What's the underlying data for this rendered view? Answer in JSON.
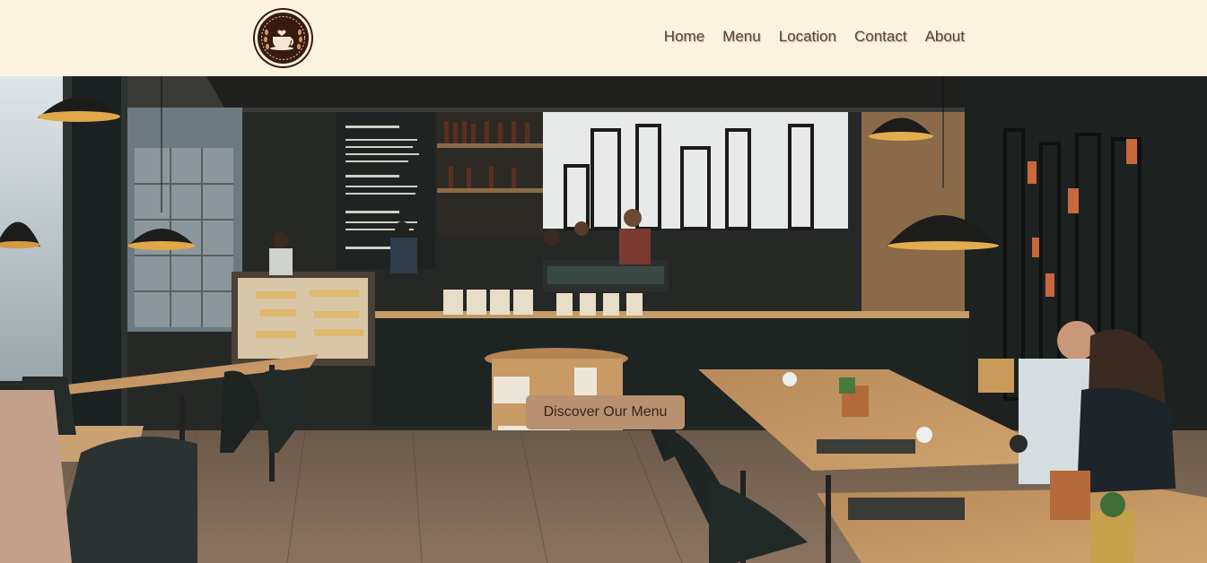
{
  "header": {
    "logo_icon": "coffee-cup-logo-icon",
    "nav": [
      {
        "label": "Home"
      },
      {
        "label": "Menu"
      },
      {
        "label": "Location"
      },
      {
        "label": "Contact"
      },
      {
        "label": "About"
      }
    ]
  },
  "hero": {
    "image": "cafe-interior-photo",
    "cta_label": "Discover Our Menu"
  },
  "colors": {
    "header_bg": "#fbf3df",
    "nav_text": "#5a4530",
    "cta_bg": "#b79170",
    "logo_bg": "#3a1a10"
  }
}
